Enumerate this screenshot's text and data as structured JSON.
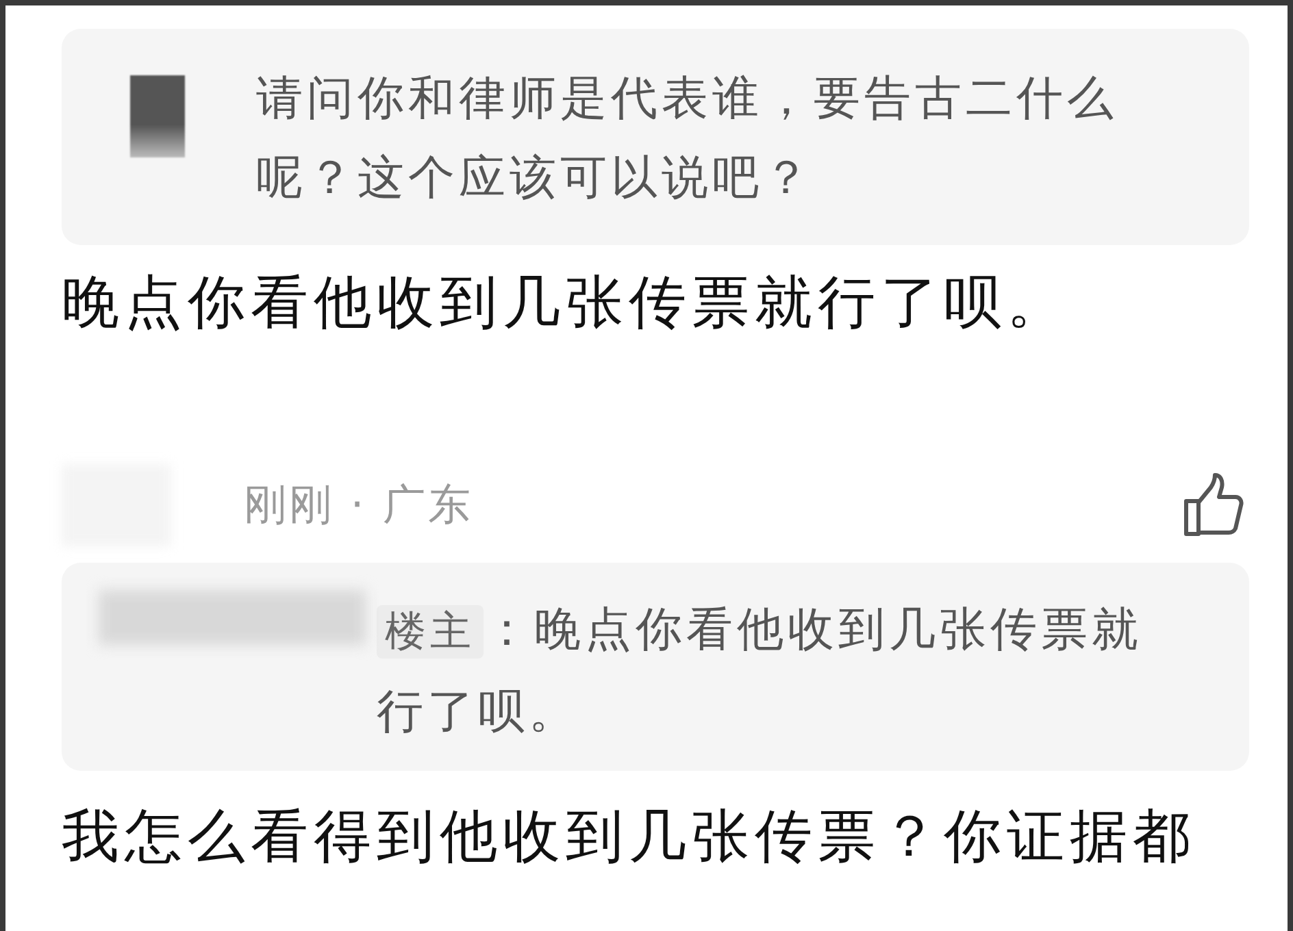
{
  "thread": [
    {
      "kind": "quote",
      "text": "请问你和律师是代表谁，要告古二什么呢？这个应该可以说吧？"
    },
    {
      "kind": "comment",
      "text": "晚点你看他收到几张传票就行了呗。"
    },
    {
      "kind": "meta",
      "text": "刚刚 · 广东"
    },
    {
      "kind": "reply_quote",
      "tag": "楼主",
      "text": "：晚点你看他收到几张传票就行了呗。"
    },
    {
      "kind": "comment",
      "text": "我怎么看得到他收到几张传票？你证据都"
    }
  ]
}
